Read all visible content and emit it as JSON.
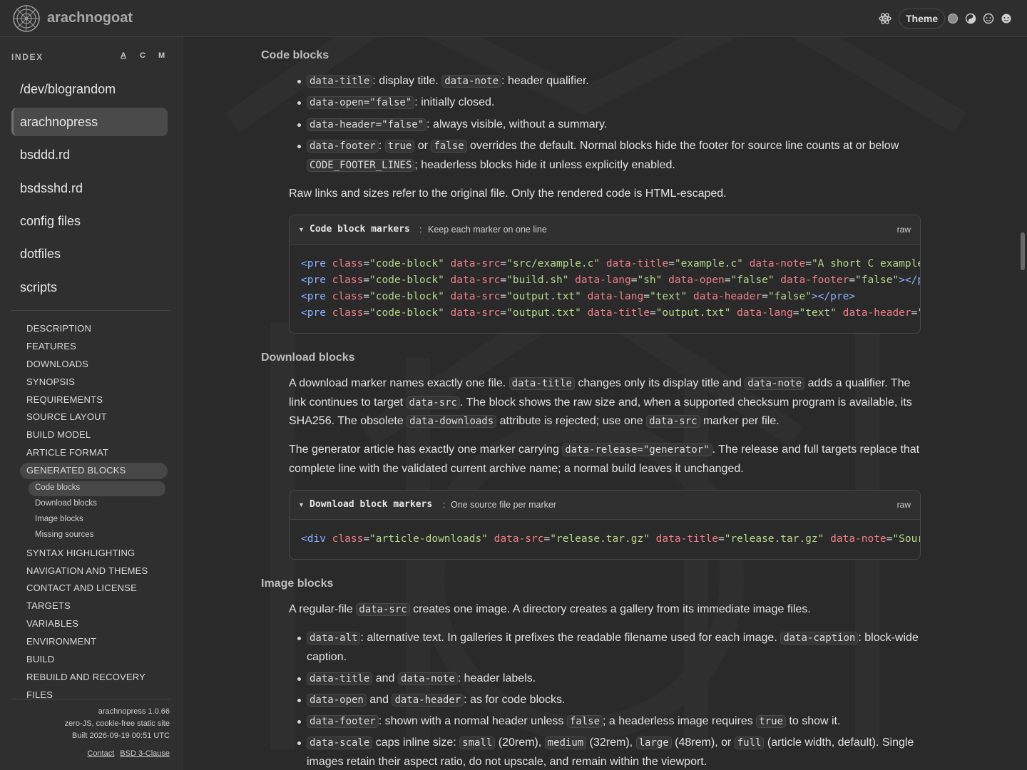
{
  "header": {
    "brand": "arachnogoat",
    "theme_label": "Theme",
    "icons": [
      "logo-icon",
      "atom-icon",
      "theme-dot-gray-icon",
      "theme-contrast-icon",
      "theme-face-icon",
      "theme-dark-face-icon"
    ]
  },
  "sidebar": {
    "index_label": "INDEX",
    "sort": [
      "A",
      "C",
      "M"
    ],
    "projects": [
      "/dev/blograndom",
      "arachnopress",
      "bsddd.rd",
      "bsdsshd.rd",
      "config files",
      "dotfiles",
      "scripts"
    ],
    "toc": [
      "DESCRIPTION",
      "FEATURES",
      "DOWNLOADS",
      "SYNOPSIS",
      "REQUIREMENTS",
      "SOURCE LAYOUT",
      "BUILD MODEL",
      "ARTICLE FORMAT",
      "GENERATED BLOCKS"
    ],
    "subtoc": [
      "Code blocks",
      "Download blocks",
      "Image blocks",
      "Missing sources"
    ],
    "toc2": [
      "SYNTAX HIGHLIGHTING",
      "NAVIGATION AND THEMES",
      "CONTACT AND LICENSE",
      "TARGETS",
      "VARIABLES",
      "ENVIRONMENT",
      "BUILD",
      "REBUILD AND RECOVERY",
      "FILES"
    ],
    "footer": {
      "version": "arachnopress 1.0.66",
      "tagline": "zero-JS, cookie-free static site",
      "built": "Built 2026-09-19 00:51 UTC",
      "contact": "Contact",
      "license": "BSD 3-Clause"
    }
  },
  "main": {
    "code_heading": "Code blocks",
    "code_items": [
      [
        "data-title",
        ": display title. ",
        "data-note",
        ": header qualifier."
      ],
      [
        "data-open=\"false\"",
        ": initially closed."
      ],
      [
        "data-header=\"false\"",
        ": always visible, without a summary."
      ]
    ],
    "footer_item": {
      "c1": "data-footer",
      "t1": ": ",
      "c2": "true",
      "t2": " or ",
      "c3": "false",
      "t3": " overrides the default. Normal blocks hide the footer for source line counts at or below",
      "c4": "CODE_FOOTER_LINES",
      "t4": "; headerless blocks hide it unless explicitly enabled."
    },
    "raw_note": "Raw links and sizes refer to the original file. Only the rendered code is HTML-escaped.",
    "code_block": {
      "title": "Code block markers",
      "sep": ":",
      "note": "Keep each marker on one line",
      "raw": "raw",
      "lines": [
        [
          [
            "tg",
            "<pre "
          ],
          [
            "at",
            "class"
          ],
          [
            "eq",
            "="
          ],
          [
            "sv",
            "\"code-block\" "
          ],
          [
            "at",
            "data-src"
          ],
          [
            "eq",
            "="
          ],
          [
            "sv",
            "\"src/example.c\" "
          ],
          [
            "at",
            "data-title"
          ],
          [
            "eq",
            "="
          ],
          [
            "sv",
            "\"example.c\" "
          ],
          [
            "at",
            "data-note"
          ],
          [
            "eq",
            "="
          ],
          [
            "sv",
            "\"A short C example\""
          ]
        ],
        [
          [
            "tg",
            "<pre "
          ],
          [
            "at",
            "class"
          ],
          [
            "eq",
            "="
          ],
          [
            "sv",
            "\"code-block\" "
          ],
          [
            "at",
            "data-src"
          ],
          [
            "eq",
            "="
          ],
          [
            "sv",
            "\"build.sh\" "
          ],
          [
            "at",
            "data-lang"
          ],
          [
            "eq",
            "="
          ],
          [
            "sv",
            "\"sh\" "
          ],
          [
            "at",
            "data-open"
          ],
          [
            "eq",
            "="
          ],
          [
            "sv",
            "\"false\" "
          ],
          [
            "at",
            "data-footer"
          ],
          [
            "eq",
            "="
          ],
          [
            "sv",
            "\"false\""
          ],
          [
            "tg",
            "></pre>"
          ]
        ],
        [
          [
            "tg",
            "<pre "
          ],
          [
            "at",
            "class"
          ],
          [
            "eq",
            "="
          ],
          [
            "sv",
            "\"code-block\" "
          ],
          [
            "at",
            "data-src"
          ],
          [
            "eq",
            "="
          ],
          [
            "sv",
            "\"output.txt\" "
          ],
          [
            "at",
            "data-lang"
          ],
          [
            "eq",
            "="
          ],
          [
            "sv",
            "\"text\" "
          ],
          [
            "at",
            "data-header"
          ],
          [
            "eq",
            "="
          ],
          [
            "sv",
            "\"false\""
          ],
          [
            "tg",
            "></pre>"
          ]
        ],
        [
          [
            "tg",
            "<pre "
          ],
          [
            "at",
            "class"
          ],
          [
            "eq",
            "="
          ],
          [
            "sv",
            "\"code-block\" "
          ],
          [
            "at",
            "data-src"
          ],
          [
            "eq",
            "="
          ],
          [
            "sv",
            "\"output.txt\" "
          ],
          [
            "at",
            "data-title"
          ],
          [
            "eq",
            "="
          ],
          [
            "sv",
            "\"output.txt\" "
          ],
          [
            "at",
            "data-lang"
          ],
          [
            "eq",
            "="
          ],
          [
            "sv",
            "\"text\" "
          ],
          [
            "at",
            "data-header"
          ],
          [
            "eq",
            "="
          ],
          [
            "sv",
            "\"false\""
          ]
        ]
      ]
    },
    "download_heading": "Download blocks",
    "download_p1": {
      "t1": "A download marker names exactly one file. ",
      "c1": "data-title",
      "t2": " changes only its display title and ",
      "c2": "data-note",
      "t3": " adds a qualifier. The link continues to target ",
      "c3": "data-src",
      "t4": ". The block shows the raw size and, when a supported checksum program is available, its SHA256. The obsolete ",
      "c4": "data-downloads",
      "t5": " attribute is rejected; use one ",
      "c5": "data-src",
      "t6": " marker per file."
    },
    "download_p2": {
      "t1": "The generator article has exactly one marker carrying ",
      "c1": "data-release=\"generator\"",
      "t2": ". The release and full targets replace that complete line with the validated current archive name; a normal build leaves it unchanged."
    },
    "download_block": {
      "title": "Download block markers",
      "sep": ":",
      "note": "One source file per marker",
      "raw": "raw",
      "lines": [
        [
          [
            "tg",
            "<div "
          ],
          [
            "at",
            "class"
          ],
          [
            "eq",
            "="
          ],
          [
            "sv",
            "\"article-downloads\" "
          ],
          [
            "at",
            "data-src"
          ],
          [
            "eq",
            "="
          ],
          [
            "sv",
            "\"release.tar.gz\" "
          ],
          [
            "at",
            "data-title"
          ],
          [
            "eq",
            "="
          ],
          [
            "sv",
            "\"release.tar.gz\" "
          ],
          [
            "at",
            "data-note"
          ],
          [
            "eq",
            "="
          ],
          [
            "sv",
            "\"Source archive\""
          ]
        ]
      ]
    },
    "image_heading": "Image blocks",
    "image_p": {
      "t1": "A regular-file ",
      "c1": "data-src",
      "t2": " creates one image. A directory creates a gallery from its immediate image files."
    },
    "image_items": {
      "alt": {
        "c1": "data-alt",
        "t1": ": alternative text. In galleries it prefixes the readable filename used for each image. ",
        "c2": "data-caption",
        "t2": ": block-wide caption."
      },
      "title": {
        "c1": "data-title",
        "t1": " and ",
        "c2": "data-note",
        "t2": ": header labels."
      },
      "open": {
        "c1": "data-open",
        "t1": " and ",
        "c2": "data-header",
        "t2": ": as for code blocks."
      },
      "footer": {
        "c1": "data-footer",
        "t1": ": shown with a normal header unless ",
        "c2": "false",
        "t2": "; a headerless image requires ",
        "c3": "true",
        "t3": " to show it."
      },
      "scale": {
        "c1": "data-scale",
        "t1": " caps inline size: ",
        "c2": "small",
        "t2": " (20rem), ",
        "c3": "medium",
        "t3": " (32rem), ",
        "c4": "large",
        "t4": " (48rem), or ",
        "c5": "full",
        "t5": " (article width, default). Single images retain their aspect ratio, do not upscale, and remain within the viewport."
      }
    }
  }
}
